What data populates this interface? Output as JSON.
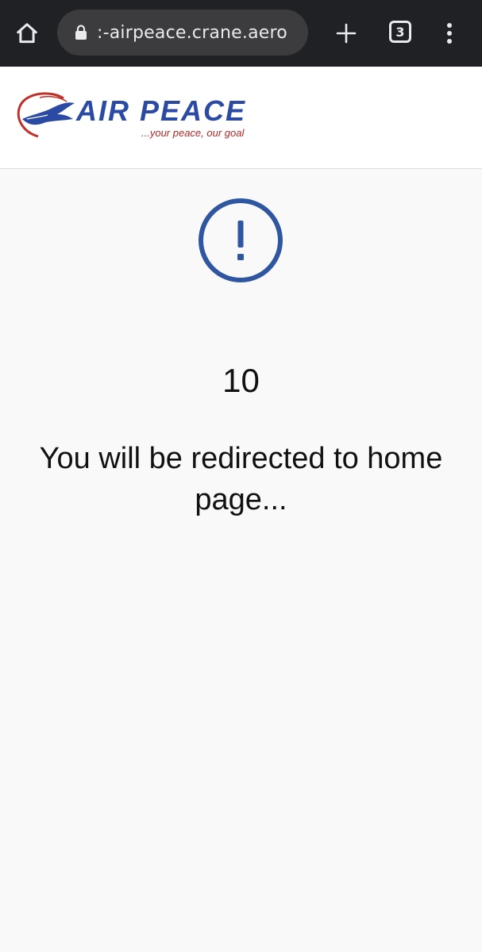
{
  "browser": {
    "url": ":-airpeace.crane.aero",
    "tab_count": "3",
    "icons": {
      "home": "home-icon",
      "lock": "lock-icon",
      "new_tab": "plus-icon",
      "menu": "more-vertical-icon"
    }
  },
  "site": {
    "brand": "AIR PEACE",
    "tagline": "...your peace, our goal",
    "colors": {
      "brand_blue": "#2b4aa3",
      "brand_red": "#b22b2b",
      "alert_blue": "#2f56a0"
    }
  },
  "main": {
    "countdown": "10",
    "message": "You will be redirected to home page...",
    "alert_icon": "exclamation-circle-icon"
  }
}
